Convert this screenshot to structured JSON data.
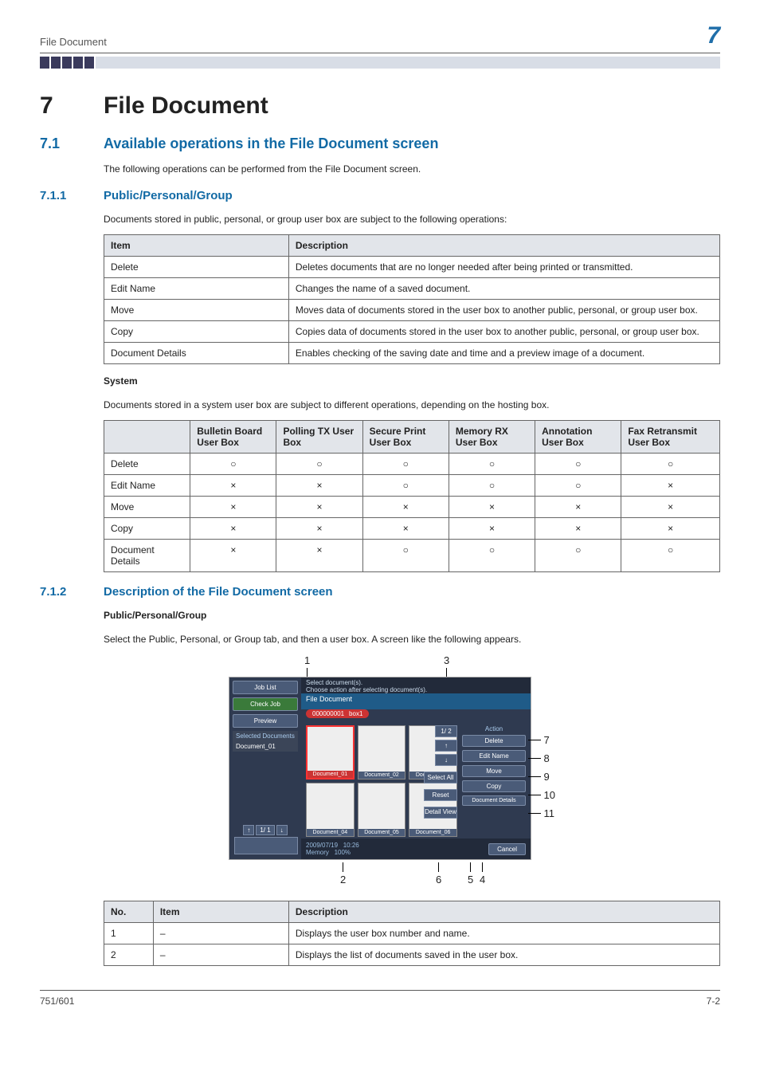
{
  "header": {
    "running_head": "File Document",
    "chapter_number_top": "7"
  },
  "chapter": {
    "number": "7",
    "title": "File Document"
  },
  "sec71": {
    "number": "7.1",
    "title": "Available operations in the File Document screen",
    "intro": "The following operations can be performed from the File Document screen."
  },
  "sec711": {
    "number": "7.1.1",
    "title": "Public/Personal/Group",
    "intro": "Documents stored in public, personal, or group user box are subject to the following operations:",
    "table_head": {
      "c1": "Item",
      "c2": "Description"
    },
    "rows": [
      {
        "item": "Delete",
        "desc": "Deletes documents that are no longer needed after being printed or transmitted."
      },
      {
        "item": "Edit Name",
        "desc": "Changes the name of a saved document."
      },
      {
        "item": "Move",
        "desc": "Moves data of documents stored in the user box to another public, personal, or group user box."
      },
      {
        "item": "Copy",
        "desc": "Copies data of documents stored in the user box to another public, personal, or group user box."
      },
      {
        "item": "Document Details",
        "desc": "Enables checking of the saving date and time and a preview image of a document."
      }
    ]
  },
  "system": {
    "heading": "System",
    "intro": "Documents stored in a system user box are subject to different operations, depending on the hosting box.",
    "head": {
      "c0": "",
      "c1": "Bulletin Board User Box",
      "c2": "Polling TX User Box",
      "c3": "Secure Print User Box",
      "c4": "Memory RX User Box",
      "c5": "Annotation User Box",
      "c6": "Fax Retransmit User Box"
    },
    "rows": [
      {
        "r0": "Delete",
        "r1": "○",
        "r2": "○",
        "r3": "○",
        "r4": "○",
        "r5": "○",
        "r6": "○"
      },
      {
        "r0": "Edit Name",
        "r1": "×",
        "r2": "×",
        "r3": "○",
        "r4": "○",
        "r5": "○",
        "r6": "×"
      },
      {
        "r0": "Move",
        "r1": "×",
        "r2": "×",
        "r3": "×",
        "r4": "×",
        "r5": "×",
        "r6": "×"
      },
      {
        "r0": "Copy",
        "r1": "×",
        "r2": "×",
        "r3": "×",
        "r4": "×",
        "r5": "×",
        "r6": "×"
      },
      {
        "r0": "Document Details",
        "r1": "×",
        "r2": "×",
        "r3": "○",
        "r4": "○",
        "r5": "○",
        "r6": "○"
      }
    ]
  },
  "sec712": {
    "number": "7.1.2",
    "title": "Description of the File Document screen",
    "sub_heading": "Public/Personal/Group",
    "intro": "Select the Public, Personal, or Group tab, and then a user box. A screen like the following appears."
  },
  "panel": {
    "left": {
      "job_list": "Job List",
      "check_job": "Check Job",
      "preview": "Preview",
      "selected_hdr": "Selected Documents",
      "selected_doc": "Document_01",
      "mini_pager": "1/ 1"
    },
    "top_msg_l1": "Select document(s).",
    "top_msg_l2": "Choose action after selecting document(s).",
    "tab": "File Document",
    "box_number": "000000001",
    "box_name": "box1",
    "thumbs": [
      "Document_01",
      "Document_02",
      "Document_03",
      "Document_04",
      "Document_05",
      "Document_06"
    ],
    "pager_txt": "1/ 2",
    "select_all": "Select All",
    "reset": "Reset",
    "detail_view": "Detail View",
    "actions_hdr": "Action",
    "actions": {
      "delete": "Delete",
      "edit": "Edit Name",
      "move": "Move",
      "copy": "Copy",
      "details": "Document Details"
    },
    "footer_date": "2009/07/19",
    "footer_time": "10:26",
    "footer_mem_label": "Memory",
    "footer_mem_val": "100%",
    "cancel": "Cancel"
  },
  "callouts": {
    "top": {
      "n1": "1",
      "n3": "3"
    },
    "right": {
      "n7": "7",
      "n8": "8",
      "n9": "9",
      "n10": "10",
      "n11": "11"
    },
    "bottom": {
      "n2": "2",
      "n6": "6",
      "n5": "5",
      "n4": "4"
    }
  },
  "desc_table": {
    "head": {
      "c1": "No.",
      "c2": "Item",
      "c3": "Description"
    },
    "rows": [
      {
        "no": "1",
        "item": "–",
        "desc": "Displays the user box number and name."
      },
      {
        "no": "2",
        "item": "–",
        "desc": "Displays the list of documents saved in the user box."
      }
    ]
  },
  "footer": {
    "left": "751/601",
    "right": "7-2"
  }
}
